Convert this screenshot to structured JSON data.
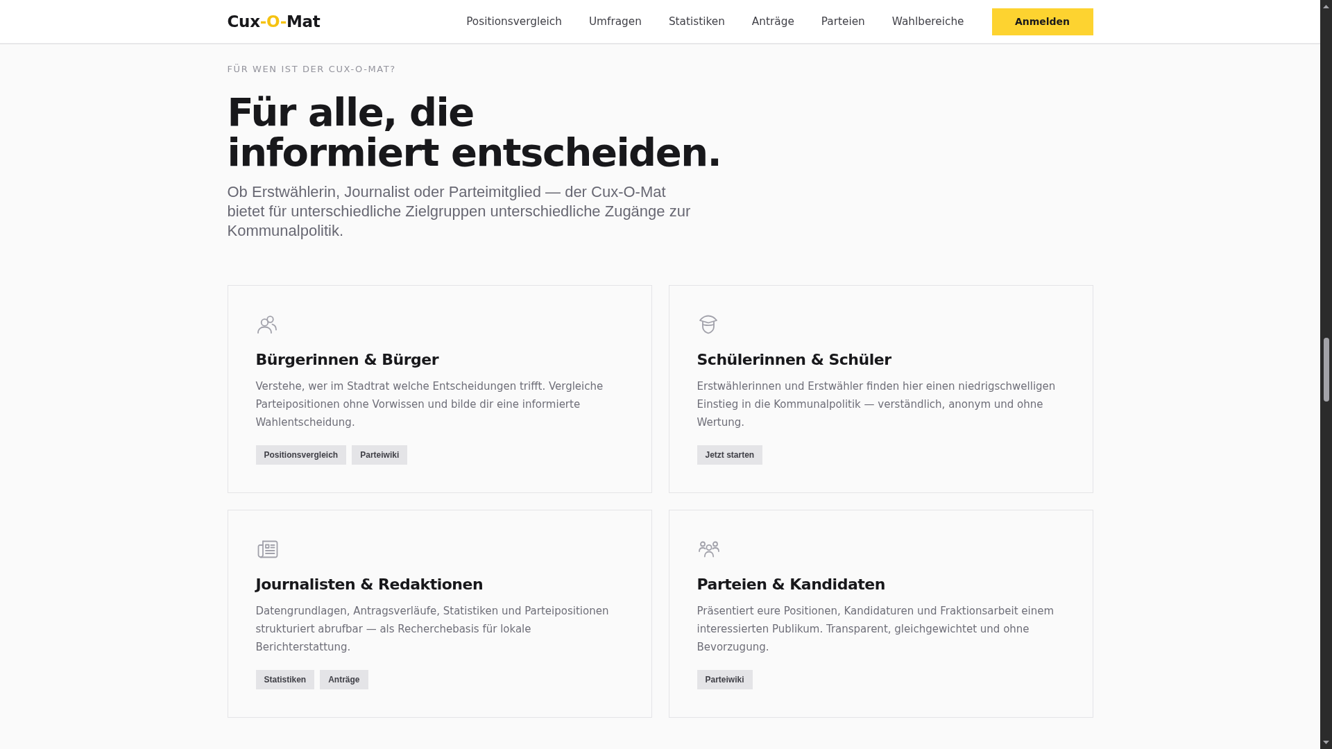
{
  "header": {
    "logo": [
      {
        "text": "Cux",
        "accent": false
      },
      {
        "text": "-O-",
        "accent": true
      },
      {
        "text": "Mat",
        "accent": false
      }
    ],
    "nav": [
      "Positionsvergleich",
      "Umfragen",
      "Statistiken",
      "Anträge",
      "Parteien",
      "Wahlbereiche"
    ],
    "login_button": "Anmelden"
  },
  "section": {
    "eyebrow": "FÜR WEN IST DER CUX-O-MAT?",
    "headline": "Für alle, die\ninformiert entscheiden.",
    "intro": "Ob Erstwählerin, Journalist oder Parteimitglied — der Cux-O-Mat bietet für unterschiedliche Zielgruppen unterschiedliche Zugänge zur Kommunalpolitik.",
    "cards": [
      {
        "title": "Bürgerinnen & Bürger",
        "text": "Verstehe, wer im Stadtrat welche Entscheidungen trifft. Vergleiche Parteipositionen ohne Vorwissen und bilde dir eine informierte Wahlentscheidung.",
        "links": [
          "Positionsvergleich",
          "Parteiwiki"
        ]
      },
      {
        "title": "Schülerinnen & Schüler",
        "text": "Erstwählerinnen und Erstwähler finden hier einen niedrigschwelligen Einstieg in die Kommunalpolitik — verständlich, anonym und ohne Wertung.",
        "links": [
          "Jetzt starten"
        ]
      },
      {
        "title": "Journalisten & Redaktionen",
        "text": "Datengrundlagen, Antragsverläufe, Statistiken und Parteipositionen strukturiert abrufbar — als Recherchebasis für lokale Berichterstattung.",
        "links": [
          "Statistiken",
          "Anträge"
        ]
      },
      {
        "title": "Parteien & Kandidaten",
        "text": "Präsentiert eure Positionen, Kandidaturen und Fraktionsarbeit einem interessierten Publikum. Transparent, gleichgewichtet und ohne Bevorzugung.",
        "links": [
          "Parteiwiki"
        ]
      }
    ]
  }
}
